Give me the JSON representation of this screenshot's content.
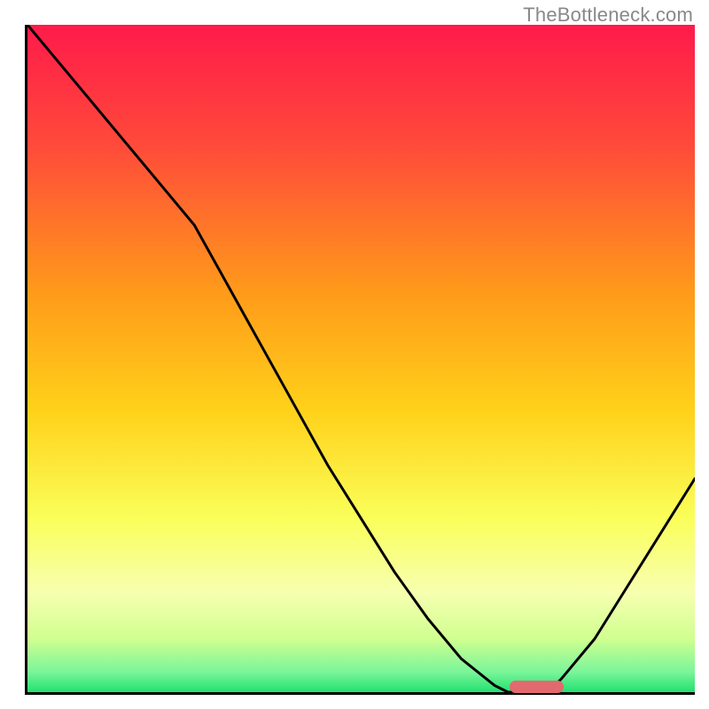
{
  "watermark": "TheBottleneck.com",
  "colors": {
    "top": "#ff1a4a",
    "mid_upper": "#ff7a2a",
    "mid": "#ffd21a",
    "mid_lower": "#faff7a",
    "lower": "#d6ff8a",
    "bottom": "#2ee87a",
    "marker": "#e26a6e",
    "curve": "#000000"
  },
  "chart_data": {
    "type": "line",
    "title": "",
    "xlabel": "",
    "ylabel": "",
    "xlim": [
      0,
      100
    ],
    "ylim": [
      0,
      100
    ],
    "x": [
      0,
      5,
      10,
      15,
      20,
      25,
      30,
      35,
      40,
      45,
      50,
      55,
      60,
      65,
      70,
      72,
      75,
      78,
      80,
      85,
      90,
      95,
      100
    ],
    "values": [
      100,
      94,
      88,
      82,
      76,
      70,
      61,
      52,
      43,
      34,
      26,
      18,
      11,
      5,
      1,
      0,
      0,
      0,
      2,
      8,
      16,
      24,
      32
    ],
    "note": "x is a normalized horizontal position (0=left axis, 100=right edge). values are normalized height (0=bottom axis, 100=top). The curve depicts a bottleneck metric that is worst (red, high value) at the left, descends to a minimum around x≈72–78, then rises again toward the right. The colored background is a vertical gradient from red (bad) at the top through yellow to green (good) at the bottom.",
    "optimum_range_x": [
      72,
      80
    ],
    "optimum_marker_y": 1.2
  }
}
